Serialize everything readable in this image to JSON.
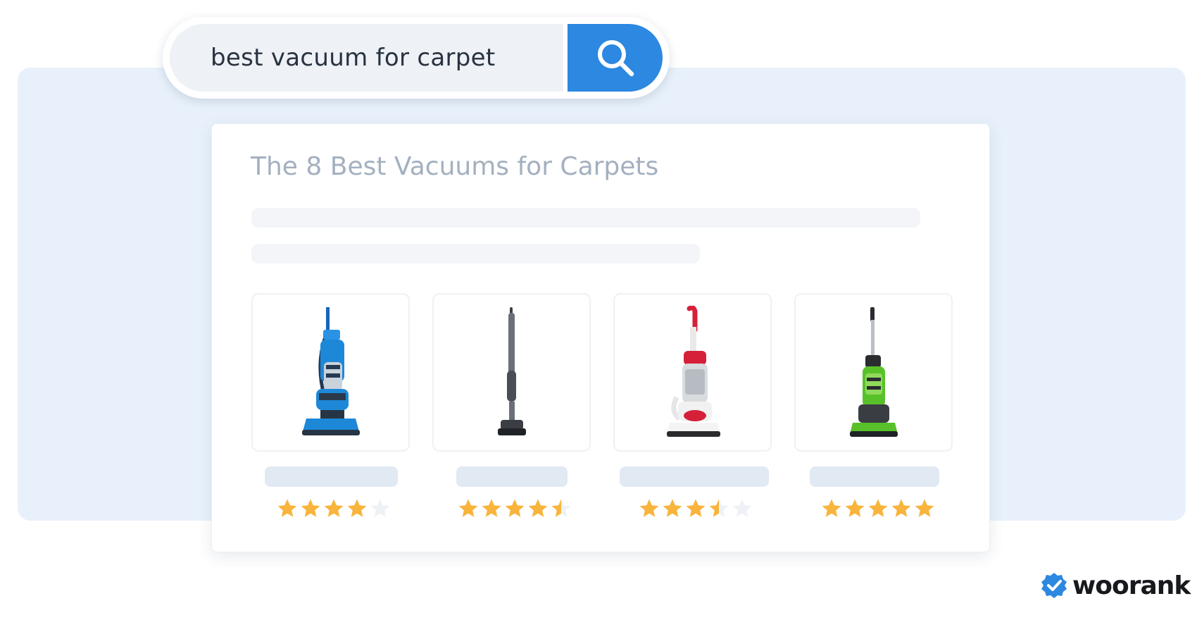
{
  "search": {
    "query": "best vacuum for carpet",
    "button_icon": "search-icon"
  },
  "result": {
    "title": "The 8 Best Vacuums for Carpets",
    "products": [
      {
        "image": "blue-upright-vacuum",
        "rating": 4,
        "accent": "#1e88d8"
      },
      {
        "image": "gray-stick-vacuum",
        "rating": 4.5,
        "accent": "#5c6168"
      },
      {
        "image": "red-white-upright-vacuum",
        "rating": 3.5,
        "accent": "#d6203a"
      },
      {
        "image": "green-upright-vacuum",
        "rating": 5,
        "accent": "#58c12a"
      }
    ]
  },
  "colors": {
    "search_button": "#2c88e0",
    "star_filled": "#f8b43c",
    "star_empty": "#eef1f5"
  },
  "brand": {
    "name": "woorank",
    "icon": "check-badge-icon"
  }
}
